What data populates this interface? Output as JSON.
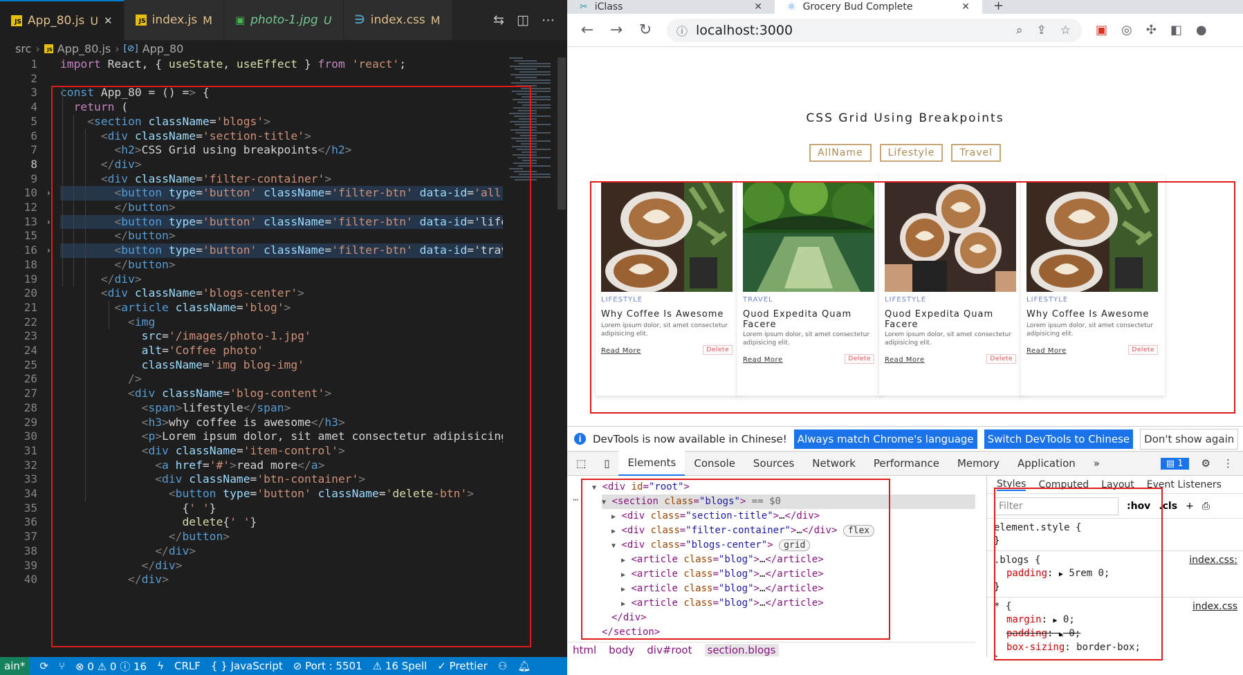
{
  "vscode": {
    "tabs": [
      {
        "name": "App_80.js",
        "status": "U",
        "icon": "js-icon",
        "active": true
      },
      {
        "name": "index.js",
        "status": "M",
        "icon": "js-icon",
        "active": false
      },
      {
        "name": "photo-1.jpg",
        "status": "U",
        "icon": "image-icon",
        "active": false
      },
      {
        "name": "index.css",
        "status": "M",
        "icon": "css-icon",
        "active": false
      }
    ],
    "breadcrumb": {
      "folder": "src",
      "file": "App_80.js",
      "symbol": "App_80"
    },
    "line_numbers": [
      "1",
      "2",
      "3",
      "4",
      "5",
      "6",
      "7",
      "8",
      "9",
      "10",
      "12",
      "13",
      "15",
      "16",
      "18",
      "19",
      "20",
      "21",
      "22",
      "23",
      "24",
      "25",
      "26",
      "27",
      "28",
      "29",
      "30",
      "31",
      "32",
      "33",
      "34",
      "35",
      "36",
      "37",
      "38",
      "39",
      "40"
    ],
    "current_line": "8",
    "code": [
      "import React, { useState, useEffect } from 'react';",
      "",
      "const App_80 = () => {",
      "  return (",
      "    <section className='blogs'>",
      "      <div className='section-title'>",
      "        <h2>CSS Grid using breakpoints</h2>",
      "      </div>",
      "      <div className='filter-container'>",
      "        <button type='button' className='filter-btn' data-id='all'>",
      "        </button>",
      "        <button type='button' className='filter-btn' data-id='lifes",
      "        </button>",
      "        <button type='button' className='filter-btn' data-id='trave",
      "        </button>",
      "      </div>",
      "      <div className='blogs-center'>",
      "        <article className='blog'>",
      "          <img",
      "            src='/images/photo-1.jpg'",
      "            alt='Coffee photo'",
      "            className='img blog-img'",
      "          />",
      "          <div className='blog-content'>",
      "            <span>lifestyle</span>",
      "            <h3>why coffee is awesome</h3>",
      "            <p>Lorem ipsum dolor, sit amet consectetur adipisicing",
      "            <div className='item-control'>",
      "              <a href='#'>read more</a>",
      "              <div className='btn-container'>",
      "                <button type='button' className='delete-btn'>",
      "                  {' '}",
      "                  delete{' '}",
      "                </button>",
      "              </div>",
      "            </div>",
      "          </div>"
    ],
    "statusbar": {
      "branch": "ain*",
      "errors": "0",
      "warnings": "0",
      "info": "16",
      "eol": "CRLF",
      "language": "JavaScript",
      "port": "Port : 5501",
      "spell": "16 Spell",
      "formatter": "Prettier"
    }
  },
  "chrome": {
    "tabs": [
      {
        "title": "iClass",
        "active": false
      },
      {
        "title": "Grocery Bud Complete",
        "active": true
      }
    ],
    "url": "localhost:3000",
    "page": {
      "title": "CSS Grid Using Breakpoints",
      "filters": [
        "AllName",
        "Lifestyle",
        "Travel"
      ],
      "cards": [
        {
          "category": "LIFESTYLE",
          "title": "Why Coffee Is Awesome",
          "text": "Lorem ipsum dolor, sit amet consectetur adipisicing elit.",
          "read": "Read More",
          "delete": "Delete",
          "image": "coffee-cups-image"
        },
        {
          "category": "TRAVEL",
          "title": "Quod Expedita Quam Facere",
          "text": "Lorem ipsum dolor, sit amet consectetur adipisicing elit.",
          "read": "Read More",
          "delete": "Delete",
          "image": "river-trees-image"
        },
        {
          "category": "LIFESTYLE",
          "title": "Quod Expedita Quam Facere",
          "text": "Lorem ipsum dolor, sit amet consectetur adipisicing elit.",
          "read": "Read More",
          "delete": "Delete",
          "image": "coffee-cheers-image"
        },
        {
          "category": "LIFESTYLE",
          "title": "Why Coffee Is Awesome",
          "text": "Lorem ipsum dolor, sit amet consectetur adipisicing elit.",
          "read": "Read More",
          "delete": "Delete",
          "image": "coffee-cups-image"
        }
      ]
    },
    "devtools": {
      "notice": "DevTools is now available in Chinese!",
      "btn_match": "Always match Chrome's language",
      "btn_switch": "Switch DevTools to Chinese",
      "btn_dismiss": "Don't show again",
      "tabs": [
        "Elements",
        "Console",
        "Sources",
        "Network",
        "Performance",
        "Memory",
        "Application",
        "»"
      ],
      "issues": "1",
      "dom": [
        {
          "text": "<div id=\"root\">",
          "depth": 0
        },
        {
          "text": "<section class=\"blogs\"> == $0",
          "depth": 1
        },
        {
          "text": "<div class=\"section-title\">…</div>",
          "depth": 2
        },
        {
          "text": "<div class=\"filter-container\">…</div>",
          "depth": 2,
          "badge": "flex"
        },
        {
          "text": "<div class=\"blogs-center\">",
          "depth": 2,
          "badge": "grid"
        },
        {
          "text": "<article class=\"blog\">…</article>",
          "depth": 3
        },
        {
          "text": "<article class=\"blog\">…</article>",
          "depth": 3
        },
        {
          "text": "<article class=\"blog\">…</article>",
          "depth": 3
        },
        {
          "text": "<article class=\"blog\">…</article>",
          "depth": 3
        },
        {
          "text": "</div>",
          "depth": 2
        },
        {
          "text": "</section>",
          "depth": 1
        }
      ],
      "crumbs": [
        "html",
        "body",
        "div#root",
        "section.blogs"
      ],
      "styles_tabs": [
        "Styles",
        "Computed",
        "Layout",
        "Event Listeners"
      ],
      "filter_placeholder": "Filter",
      "hov": ":hov",
      "cls": ".cls",
      "rules": {
        "element_style": "element.style {",
        "blogs_selector": ".blogs {",
        "blogs_padding_name": "padding",
        "blogs_padding_value": "5rem 0;",
        "blogs_source": "index.css:",
        "star_selector": "* {",
        "star_source": "index.css",
        "margin_name": "margin",
        "margin_value": "0;",
        "padding_name": "padding",
        "padding_value": "0;",
        "boxsizing_name": "box-sizing",
        "boxsizing_value": "border-box;"
      }
    }
  }
}
